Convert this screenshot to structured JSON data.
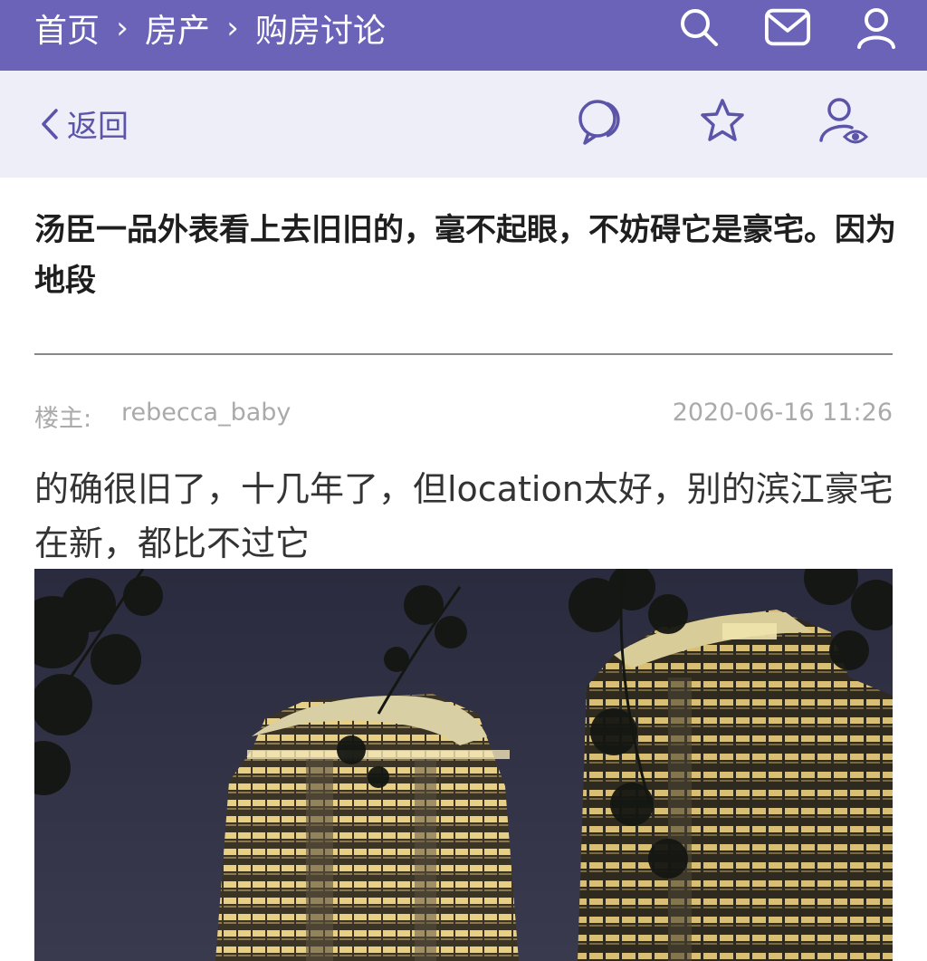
{
  "breadcrumb": {
    "items": [
      "首页",
      "房产",
      "购房讨论"
    ],
    "separator": "›"
  },
  "top_icons": [
    "search-icon",
    "mail-icon",
    "user-icon"
  ],
  "subbar": {
    "back_label": "返回",
    "icons": [
      "comment-icon",
      "star-icon",
      "user-watch-icon"
    ]
  },
  "post": {
    "title": "汤臣一品外表看上去旧旧的，毫不起眼，不妨碍它是豪宅。因为地段",
    "author_label": "楼主:",
    "author": "rebecca_baby",
    "timestamp": "2020-06-16 11:26",
    "body": "的确很旧了，十几年了，但location太好，别的滨江豪宅在新，都比不过它"
  },
  "colors": {
    "topbar": "#6b63b8",
    "subbar": "#eeeef8",
    "accent": "#5b54a8"
  }
}
